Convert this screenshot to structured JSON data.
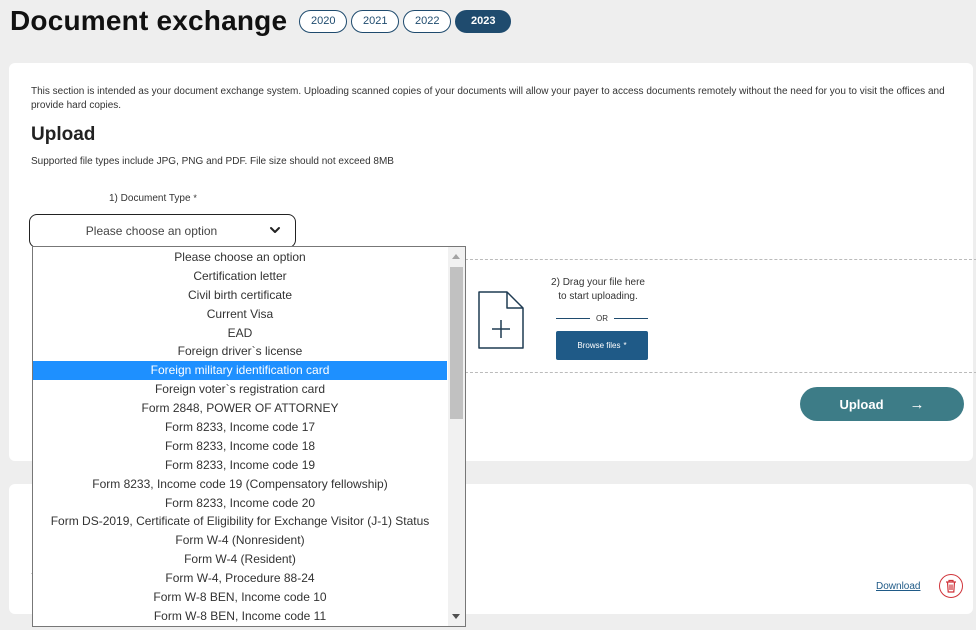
{
  "header": {
    "title": "Document exchange",
    "years": [
      {
        "label": "2020",
        "active": false
      },
      {
        "label": "2021",
        "active": false
      },
      {
        "label": "2022",
        "active": false
      },
      {
        "label": "2023",
        "active": true
      }
    ]
  },
  "main": {
    "intro": "This section is intended as your document exchange system. Uploading scanned copies of your documents will allow your payer to access documents remotely without the need for you to visit the offices and provide hard copies.",
    "upload_heading": "Upload",
    "file_types": "Supported file types include JPG, PNG and PDF. File size should not exceed 8MB",
    "doc_type_label": "1) Document Type",
    "required_mark": "*",
    "select_value": "Please choose an option",
    "drag_line1": "2) Drag your file here",
    "drag_line2": "to start uploading.",
    "or_text": "OR",
    "browse_label": "Browse files",
    "upload_label": "Upload",
    "upload_arrow": "→"
  },
  "second_card": {
    "download_label": "Download"
  },
  "dropdown": {
    "selected_index": 6,
    "options": [
      "Please choose an option",
      "Certification letter",
      "Civil birth certificate",
      "Current Visa",
      "EAD",
      "Foreign driver`s license",
      "Foreign military identification card",
      "Foreign voter`s registration card",
      "Form 2848, POWER OF ATTORNEY",
      "Form 8233, Income code 17",
      "Form 8233, Income code 18",
      "Form 8233, Income code 19",
      "Form 8233, Income code 19 (Compensatory fellowship)",
      "Form 8233, Income code 20",
      "Form DS-2019, Certificate of Eligibility for Exchange Visitor (J-1) Status",
      "Form W-4 (Nonresident)",
      "Form W-4 (Resident)",
      "Form W-4, Procedure 88-24",
      "Form W-8 BEN, Income code 10",
      "Form W-8 BEN, Income code 11"
    ]
  },
  "colors": {
    "brand_navy": "#1f4b6e",
    "browse_blue": "#1f5a87",
    "upload_teal": "#3d7c87",
    "selected_option": "#1e90ff",
    "delete_red": "#d0343a"
  },
  "icons": {
    "select_chevron": "chevron-down-icon",
    "file": "file-plus-icon",
    "delete": "trash-icon",
    "upload_arrow": "arrow-right-icon"
  }
}
